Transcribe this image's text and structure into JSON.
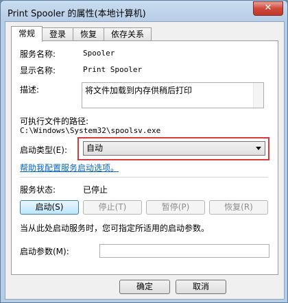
{
  "window": {
    "title": "Print Spooler 的属性(本地计算机)",
    "close_glyph": "✕"
  },
  "tabs": [
    {
      "label": "常规",
      "active": true
    },
    {
      "label": "登录"
    },
    {
      "label": "恢复"
    },
    {
      "label": "依存关系"
    }
  ],
  "general": {
    "service_name_label": "服务名称:",
    "service_name_value": "Spooler",
    "display_name_label": "显示名称:",
    "display_name_value": "Print Spooler",
    "description_label": "描述:",
    "description_value": "将文件加载到内存供稍后打印",
    "path_label": "可执行文件的路径:",
    "path_value": "C:\\Windows\\System32\\spoolsv.exe",
    "startup_type_label": "启动类型(E):",
    "startup_type_value": "自动",
    "help_link": "帮助我配置服务启动选项。",
    "status_label": "服务状态:",
    "status_value": "已停止",
    "buttons": {
      "start": "启动(S)",
      "stop": "停止(T)",
      "pause": "暂停(P)",
      "resume": "恢复(R)"
    },
    "hint": "当从此处启动服务时，您可指定所适用的启动参数。",
    "params_label": "启动参数(M):",
    "params_value": ""
  },
  "footer": {
    "ok": "确定",
    "cancel": "取消"
  },
  "accent": {
    "highlight": "#d73a3a",
    "link": "#0066cc"
  }
}
